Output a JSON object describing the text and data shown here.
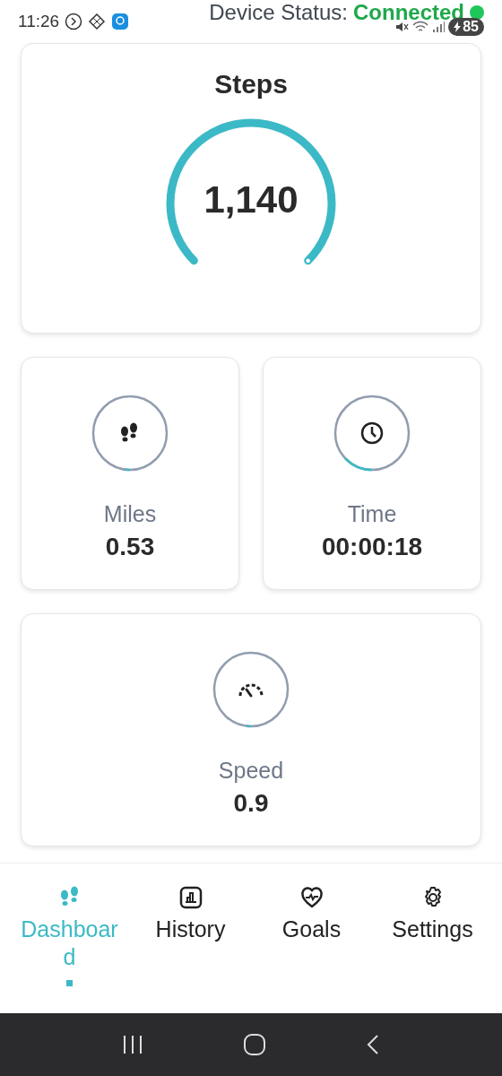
{
  "status_bar": {
    "time": "11:26",
    "device_status_label": "Device Status:",
    "device_status_value": "Connected",
    "connected": true,
    "battery": "85"
  },
  "steps": {
    "title": "Steps",
    "value": "1,140"
  },
  "metrics": [
    {
      "kind": "miles",
      "label": "Miles",
      "value": "0.53"
    },
    {
      "kind": "time",
      "label": "Time",
      "value": "00:00:18"
    },
    {
      "kind": "speed",
      "label": "Speed",
      "value": "0.9"
    }
  ],
  "tabs": [
    {
      "kind": "dashboard",
      "label": "Dashboard",
      "selected": true
    },
    {
      "kind": "history",
      "label": "History",
      "selected": false
    },
    {
      "kind": "goals",
      "label": "Goals",
      "selected": false
    },
    {
      "kind": "settings",
      "label": "Settings",
      "selected": false
    }
  ]
}
